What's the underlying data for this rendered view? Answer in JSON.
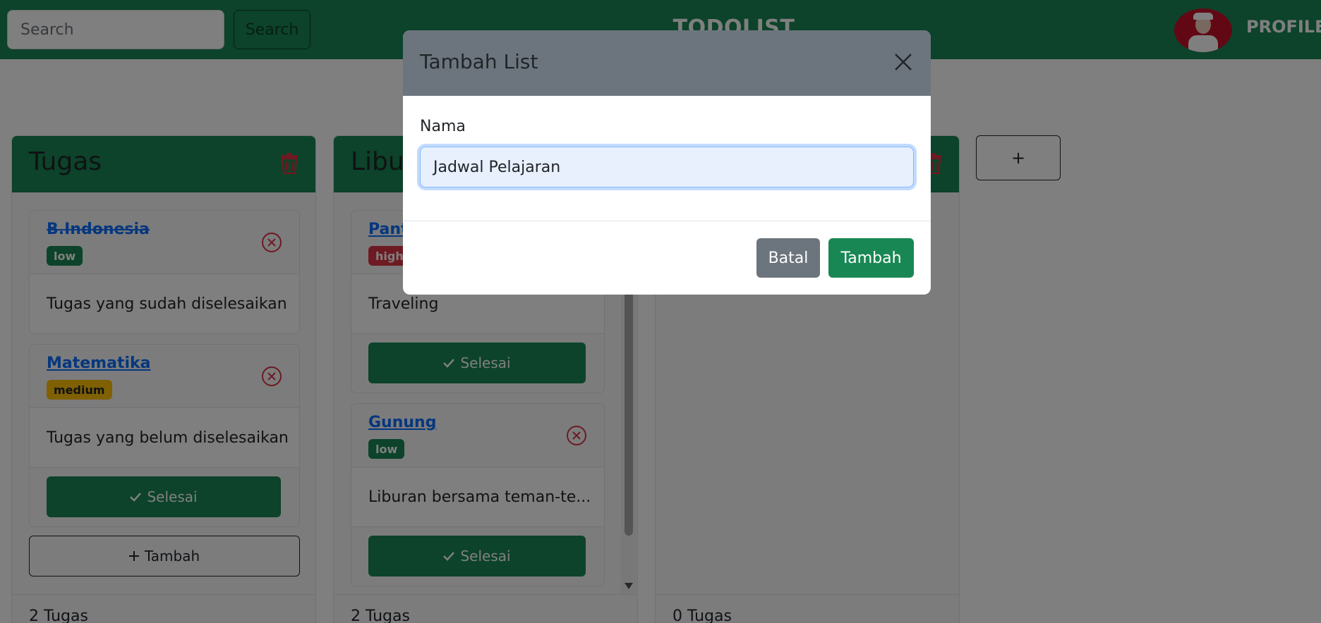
{
  "navbar": {
    "search_placeholder": "Search",
    "search_button": "Search",
    "brand": "TODOLIST",
    "profile_label": "PROFILE"
  },
  "columns": [
    {
      "title": "Tugas",
      "cards": [
        {
          "title": "B.Indonesia",
          "priority": "low",
          "description": "Tugas yang sudah diselesaikan",
          "done": true
        },
        {
          "title": "Matematika",
          "priority": "medium",
          "description": "Tugas yang belum diselesaikan",
          "done": false,
          "action": "Selesai"
        }
      ],
      "add_button": "Tambah",
      "count_text": "2 Tugas"
    },
    {
      "title": "Libur",
      "cards": [
        {
          "title": "Pant",
          "priority": "high",
          "description": "Traveling",
          "done": false,
          "action": "Selesai"
        },
        {
          "title": "Gunung",
          "priority": "low",
          "description": "Liburan bersama teman-te...",
          "done": false,
          "action": "Selesai"
        }
      ],
      "count_text": "2 Tugas"
    },
    {
      "title": "",
      "cards": [],
      "count_text": "0 Tugas"
    }
  ],
  "add_column_label": "+",
  "modal": {
    "title": "Tambah List",
    "field_label": "Nama",
    "field_value": "Jadwal Pelajaran",
    "cancel_label": "Batal",
    "submit_label": "Tambah"
  },
  "colors": {
    "primary_green": "#198754",
    "danger_red": "#dc3545",
    "warning_yellow": "#ffc107",
    "link_blue": "#0d6efd",
    "secondary_gray": "#6c757d"
  }
}
